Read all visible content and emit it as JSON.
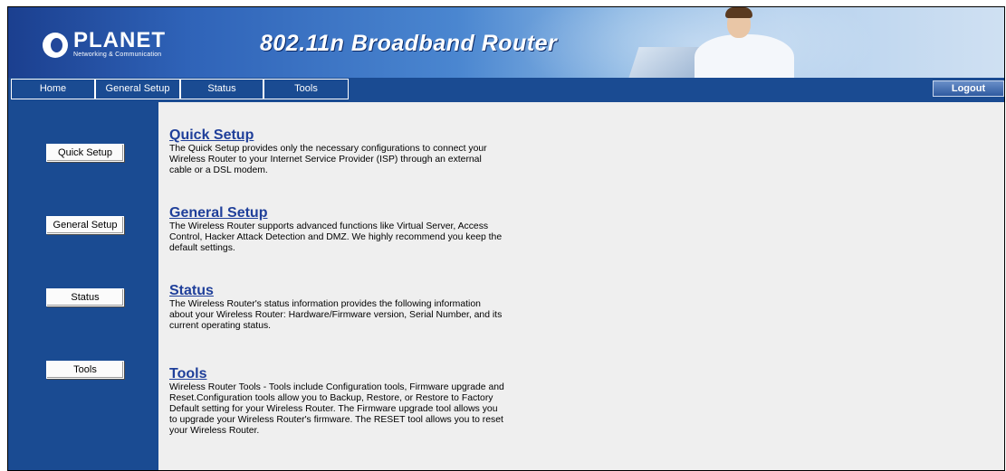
{
  "header": {
    "logo_name": "PLANET",
    "logo_tagline": "Networking & Communication",
    "product_title": "802.11n Broadband Router"
  },
  "nav": {
    "items": [
      {
        "label": "Home"
      },
      {
        "label": "General Setup"
      },
      {
        "label": "Status"
      },
      {
        "label": "Tools"
      }
    ],
    "logout_label": "Logout"
  },
  "sidebar": {
    "buttons": [
      {
        "label": "Quick Setup"
      },
      {
        "label": "General Setup"
      },
      {
        "label": "Status"
      },
      {
        "label": "Tools"
      }
    ]
  },
  "sections": [
    {
      "title": "Quick Setup",
      "description": "The Quick Setup provides only the necessary configurations to connect your Wireless Router to your Internet Service Provider (ISP) through an external cable or a DSL modem."
    },
    {
      "title": "General Setup",
      "description": "The Wireless Router supports advanced functions like Virtual Server, Access Control, Hacker Attack Detection and DMZ. We highly recommend you keep the default settings."
    },
    {
      "title": "Status",
      "description": "The Wireless Router's status information provides the following information about your Wireless Router: Hardware/Firmware version, Serial Number, and its current operating status."
    },
    {
      "title": "Tools",
      "description": "Wireless Router Tools - Tools include Configuration tools, Firmware upgrade and Reset.Configuration tools allow you to Backup, Restore, or Restore to Factory Default setting for your Wireless Router. The Firmware upgrade tool allows you to upgrade your Wireless Router's firmware. The RESET tool allows you to reset your Wireless Router."
    }
  ],
  "colors": {
    "nav_bg": "#1a4b92",
    "link": "#1f3f9a",
    "content_bg": "#efefef"
  }
}
